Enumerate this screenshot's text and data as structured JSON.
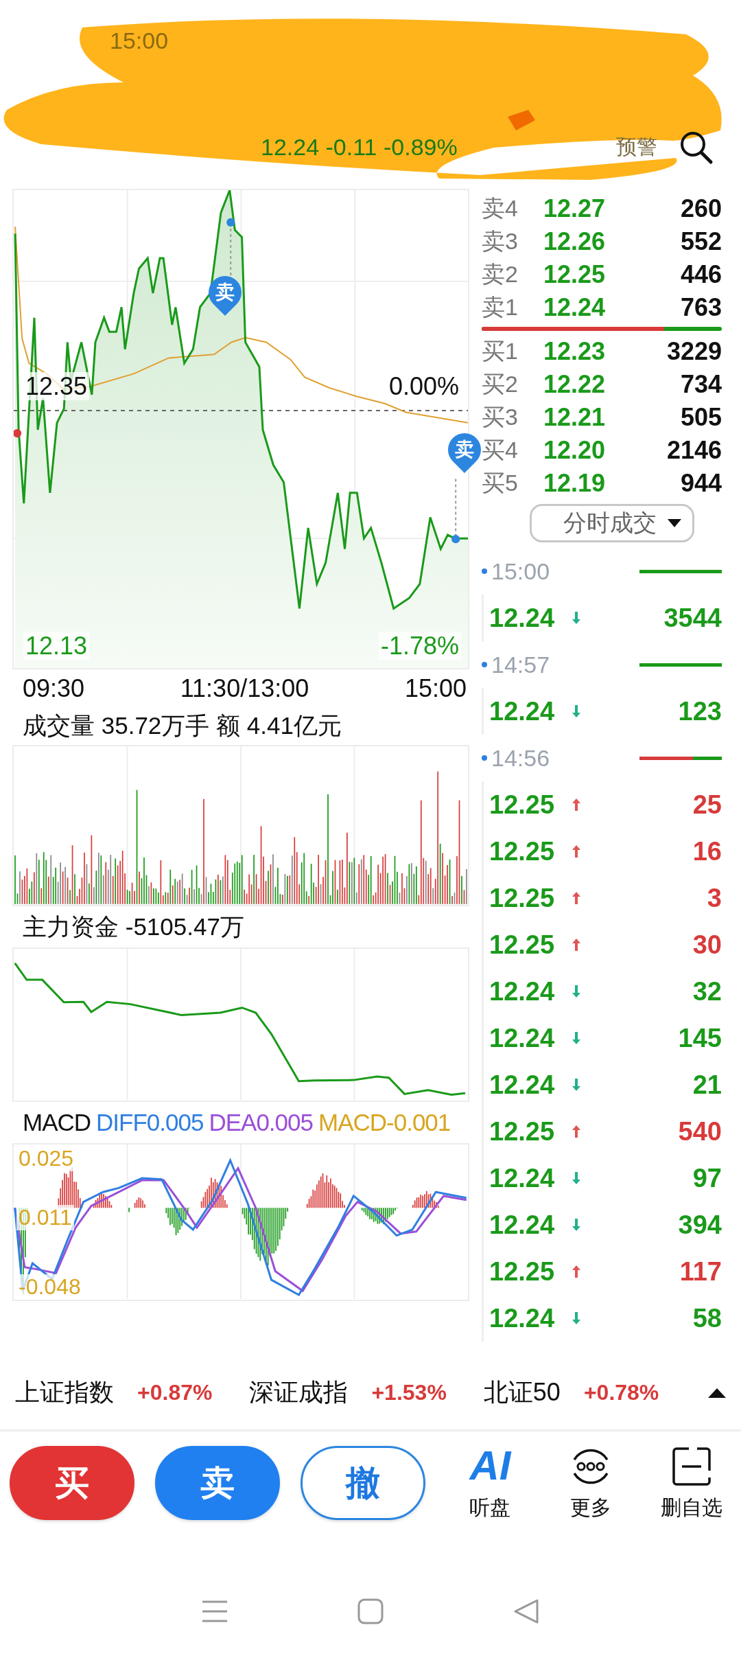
{
  "status_bar": {
    "time": "15:00"
  },
  "header": {
    "quote": "12.24 -0.11 -0.89%",
    "alert_label": "预警"
  },
  "price_chart": {
    "prev_close": "12.35",
    "prev_close_change": "0.00%",
    "low": "12.13",
    "low_change": "-1.78%",
    "time_labels": [
      "09:30",
      "11:30/13:00",
      "15:00"
    ],
    "markers": [
      {
        "label": "卖",
        "kind": "sell"
      },
      {
        "label": "卖",
        "kind": "sell"
      }
    ]
  },
  "volume": {
    "title": "成交量 35.72万手 额 4.41亿元"
  },
  "main_fund": {
    "title": "主力资金 -5105.47万"
  },
  "macd": {
    "legend": [
      {
        "label": "MACD",
        "color": "#111111"
      },
      {
        "label": "DIFF0.005",
        "color": "#2f7fe0"
      },
      {
        "label": "DEA0.005",
        "color": "#9b4fd8"
      },
      {
        "label": "MACD-0.001",
        "color": "#d9a520"
      }
    ],
    "axis_labels": [
      "0.025",
      "0.011",
      "-0.048"
    ]
  },
  "order_book": {
    "asks": [
      {
        "label": "卖4",
        "price": "12.27",
        "volume": "260"
      },
      {
        "label": "卖3",
        "price": "12.26",
        "volume": "552"
      },
      {
        "label": "卖2",
        "price": "12.25",
        "volume": "446"
      },
      {
        "label": "卖1",
        "price": "12.24",
        "volume": "763"
      }
    ],
    "balance": {
      "level": 0.76
    },
    "bids": [
      {
        "label": "买1",
        "price": "12.23",
        "volume": "3229"
      },
      {
        "label": "买2",
        "price": "12.22",
        "volume": "734"
      },
      {
        "label": "买3",
        "price": "12.21",
        "volume": "505"
      },
      {
        "label": "买4",
        "price": "12.20",
        "volume": "2146"
      },
      {
        "label": "买5",
        "price": "12.19",
        "volume": "944"
      }
    ]
  },
  "trades": {
    "selector": "分时成交",
    "groups": [
      {
        "time": "15:00",
        "level": 1,
        "rows": [
          {
            "price": "12.24",
            "kind": "down",
            "volume": "3544"
          }
        ]
      },
      {
        "time": "14:57",
        "level": 1,
        "rows": [
          {
            "price": "12.24",
            "kind": "down",
            "volume": "123"
          }
        ]
      },
      {
        "time": "14:56",
        "level": 0.35,
        "rows": [
          {
            "price": "12.25",
            "kind": "up",
            "volume": "25"
          },
          {
            "price": "12.25",
            "kind": "up",
            "volume": "16"
          },
          {
            "price": "12.25",
            "kind": "up",
            "volume": "3"
          },
          {
            "price": "12.25",
            "kind": "up",
            "volume": "30"
          },
          {
            "price": "12.24",
            "kind": "down",
            "volume": "32"
          },
          {
            "price": "12.24",
            "kind": "down",
            "volume": "145"
          },
          {
            "price": "12.24",
            "kind": "down",
            "volume": "21"
          },
          {
            "price": "12.25",
            "kind": "up",
            "volume": "540"
          },
          {
            "price": "12.24",
            "kind": "down",
            "volume": "97"
          },
          {
            "price": "12.24",
            "kind": "down",
            "volume": "394"
          },
          {
            "price": "12.25",
            "kind": "up",
            "volume": "117"
          },
          {
            "price": "12.24",
            "kind": "down",
            "volume": "58"
          }
        ]
      }
    ]
  },
  "index_bar": {
    "items": [
      {
        "name": "上证指数",
        "change": "+0.87%",
        "kind": "up"
      },
      {
        "name": "深证成指",
        "change": "+1.53%",
        "kind": "up"
      },
      {
        "name": "北证50",
        "change": "+0.78%",
        "kind": "up"
      }
    ]
  },
  "actions": {
    "trade_buttons": [
      {
        "label": "买",
        "kind": "buy"
      },
      {
        "label": "卖",
        "kind": "sell"
      },
      {
        "label": "撤",
        "kind": "cancel"
      }
    ],
    "tools": [
      {
        "kind": "ai",
        "badge": "AI",
        "label": "听盘"
      },
      {
        "kind": "more",
        "label": "更多"
      },
      {
        "kind": "remove",
        "label": "删自选"
      }
    ]
  }
}
